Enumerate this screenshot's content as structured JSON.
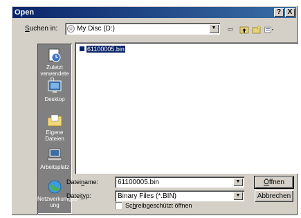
{
  "window": {
    "title": "Open",
    "help_label": "?",
    "close_label": "X"
  },
  "lookin": {
    "label_prefix": "",
    "label_underlined": "S",
    "label_rest": "uchen in:",
    "value": "My Disc (D:)",
    "icon": "cd-icon"
  },
  "toolbar": {
    "back_icon": "back-arrow-icon",
    "up_icon": "up-folder-icon",
    "newfolder_icon": "new-folder-icon",
    "view_icon": "view-menu-icon"
  },
  "places": [
    {
      "label": "Zuletzt verwendete D...",
      "icon": "recent-documents-icon"
    },
    {
      "label": "Desktop",
      "icon": "desktop-icon"
    },
    {
      "label": "Eigene Dateien",
      "icon": "my-documents-icon"
    },
    {
      "label": "Arbeitsplatz",
      "icon": "my-computer-icon"
    },
    {
      "label": "Netzwerkumgeb ung",
      "icon": "network-icon"
    }
  ],
  "files": [
    {
      "name": "61100005.bin",
      "selected": true
    }
  ],
  "filename": {
    "label_pre": "Datei",
    "label_u": "n",
    "label_post": "ame:",
    "value": "61100005.bin"
  },
  "filetype": {
    "label_pre": "Datei",
    "label_u": "t",
    "label_post": "yp:",
    "value": "Binary Files (*.BIN)"
  },
  "readonly": {
    "label_pre": "Sc",
    "label_u": "h",
    "label_post": "reibgeschützt öffnen",
    "checked": false
  },
  "buttons": {
    "open_pre": "",
    "open_u": "Ö",
    "open_post": "ffnen",
    "cancel": "Abbrechen"
  }
}
